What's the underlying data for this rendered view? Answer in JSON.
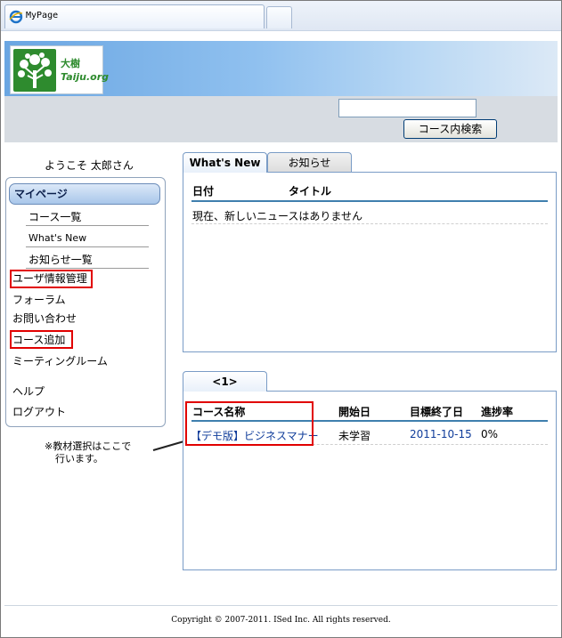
{
  "browser": {
    "tab_title": "MyPage"
  },
  "logo": {
    "line1": "大樹",
    "line2": "Taiju.org"
  },
  "search": {
    "value": "",
    "button_label": "コース内検索"
  },
  "sidebar": {
    "welcome": "ようこそ 太郎さん",
    "mypage_label": "マイページ",
    "sub_items": [
      "コース一覧",
      "What's New",
      "お知らせ一覧"
    ],
    "items": [
      "ユーザ情報管理",
      "フォーラム",
      "お問い合わせ",
      "コース追加",
      "ミーティングルーム",
      "ヘルプ",
      "ログアウト"
    ]
  },
  "note": {
    "line1": "※教材選択はここで",
    "line2": "行います。"
  },
  "news": {
    "tabs": [
      "What's New",
      "お知らせ"
    ],
    "headers": [
      "日付",
      "タイトル"
    ],
    "empty_message": "現在、新しいニュースはありません"
  },
  "courses": {
    "tab_label": "<1>",
    "headers": [
      "コース名称",
      "開始日",
      "目標終了日",
      "進捗率"
    ],
    "rows": [
      {
        "name": "【デモ版】ビジネスマナー",
        "start": "未学習",
        "target_end": "2011-10-15",
        "progress": "0%"
      }
    ]
  },
  "footer": {
    "copyright": "Copyright © 2007-2011. ISed Inc. All rights reserved."
  },
  "colors": {
    "highlight": "#e10000",
    "header_blue": "#6aa6e2",
    "link": "#0f3c9a"
  }
}
